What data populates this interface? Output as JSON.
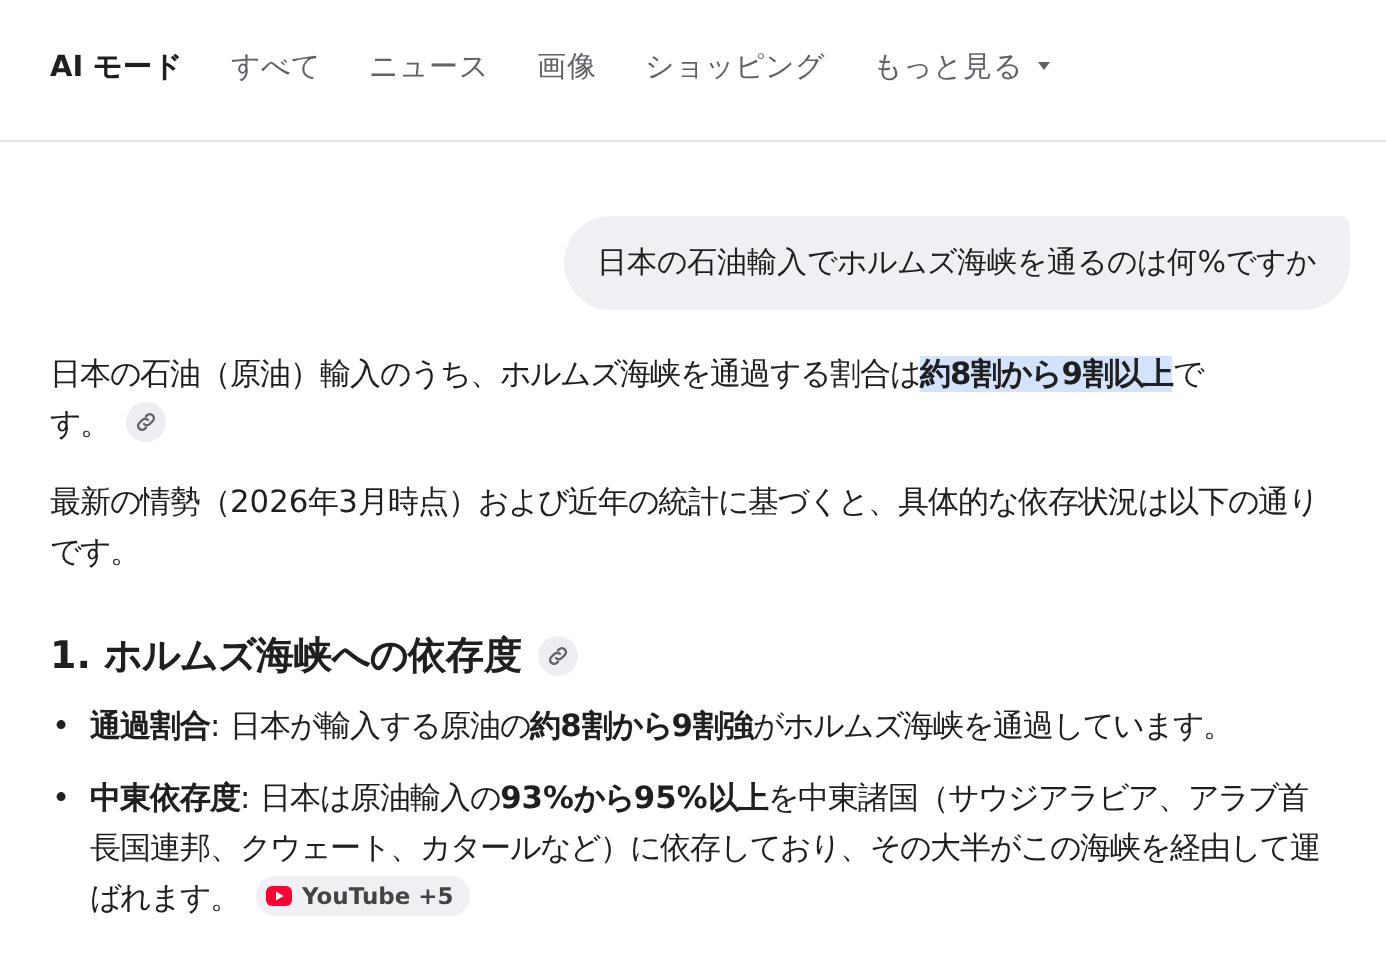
{
  "tabs": [
    {
      "label": "AI モード",
      "selected": true,
      "kind": "plain"
    },
    {
      "label": "すべて",
      "selected": false,
      "kind": "plain"
    },
    {
      "label": "ニュース",
      "selected": false,
      "kind": "plain"
    },
    {
      "label": "画像",
      "selected": false,
      "kind": "plain"
    },
    {
      "label": "ショッピング",
      "selected": false,
      "kind": "plain"
    },
    {
      "label": "もっと見る",
      "selected": false,
      "kind": "dropdown"
    }
  ],
  "query": "日本の石油輸入でホルムズ海峡を通るのは何%ですか",
  "answer": {
    "paragraphs": [
      {
        "text": "日本の石油（原油）輸入のうち、ホルムズ海峡を通過する割合は**約8割から9割以上**です。",
        "highlighted": true,
        "link": true
      },
      {
        "text": "最新の情勢（2026年3月時点）および近年の統計に基づくと、具体的な依存状況は以下の通りです。",
        "highlighted": false,
        "link": false
      }
    ],
    "sections": [
      {
        "heading": "1. ホルムズ海峡への依存度",
        "link": true,
        "bullets": [
          {
            "marker": "•",
            "text": "**通過割合**: 日本が輸入する原油の**約8割から9割強**がホルムズ海峡を通過しています。"
          },
          {
            "marker": "•",
            "text": "**中東依存度**: 日本は原油輸入の**93%から95%以上**を中東諸国（サウジアラビア、アラブ首長国連邦、クウェート、カタールなど）に依存しており、その大半がこの海峡を経由して運ばれます。",
            "source": "YouTube +5"
          }
        ]
      }
    ]
  }
}
